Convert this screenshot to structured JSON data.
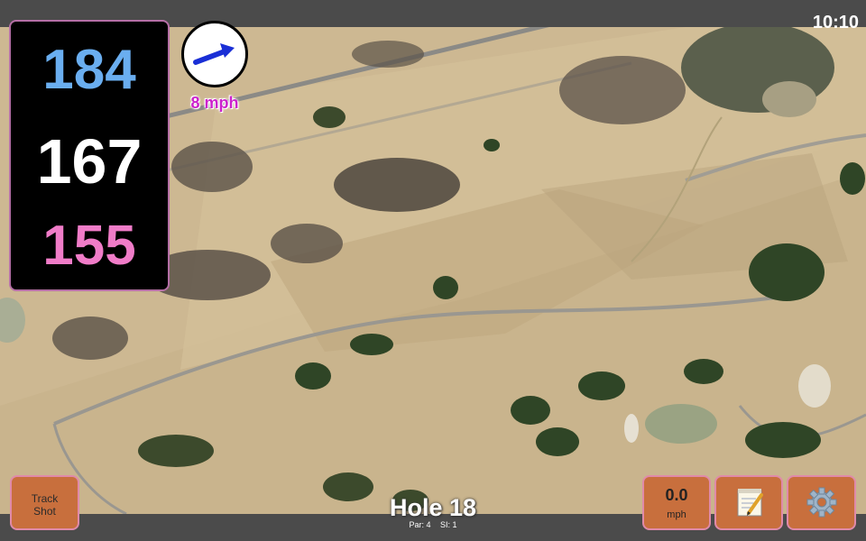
{
  "status": {
    "time": "10:10"
  },
  "distances": {
    "back": "184",
    "middle": "167",
    "front": "155",
    "colors": {
      "back": "#6aaef0",
      "middle": "#ffffff",
      "front": "#f07cc8"
    }
  },
  "wind": {
    "speed": "8 mph",
    "icon": "wind-arrow-icon",
    "color": "#1a2fd6"
  },
  "buttons": {
    "track_shot": "Track\nShot",
    "speed_value": "0.0",
    "speed_unit": "mph",
    "notes_icon": "notepad-icon",
    "settings_icon": "gear-icon"
  },
  "hole": {
    "title": "Hole 18",
    "par": "Par: 4",
    "si": "SI: 1"
  },
  "colors": {
    "button": "#c86f3d",
    "button_border": "#e08aa9",
    "map_sand": "#cdb892"
  }
}
